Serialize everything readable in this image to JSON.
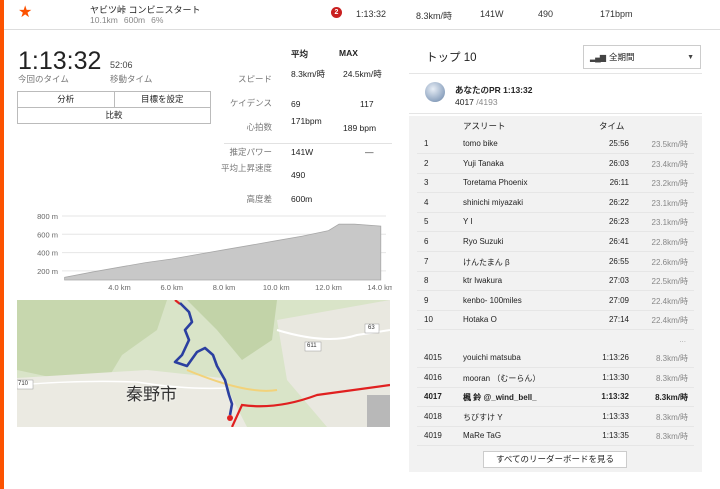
{
  "topbar": {
    "segment_name": "ヤビツ峠 コンビニスタート",
    "distance": "10.1km",
    "elev_gain": "600m",
    "grade": "6%",
    "badge": "2",
    "time": "1:13:32",
    "speed": "8.3km/時",
    "power": "141W",
    "vam": "490",
    "heartrate": "171bpm"
  },
  "effort": {
    "elapsed": "1:13:32",
    "elapsed_label": "今回のタイム",
    "moving": "52:06",
    "moving_label": "移動タイム",
    "buttons": {
      "analysis": "分析",
      "set_goal": "目標を設定",
      "compare": "比較"
    }
  },
  "stats": {
    "avg_header": "平均",
    "max_header": "MAX",
    "rows": [
      {
        "label": "スピード",
        "avg": "8.3km/時",
        "max": "24.5km/時"
      },
      {
        "label": "ケイデンス",
        "avg": "69",
        "max": "117"
      },
      {
        "label": "心拍数",
        "avg": "171bpm",
        "max": "189 bpm"
      },
      {
        "label": "推定パワー",
        "avg": "141W",
        "max": "—"
      },
      {
        "label": "平均上昇速度",
        "avg": "490",
        "max": ""
      },
      {
        "label": "高度差",
        "avg": "600m",
        "max": ""
      }
    ]
  },
  "chart_data": {
    "type": "area",
    "ylabel": "",
    "xlabel": "",
    "y_ticks": [
      "200 m",
      "400 m",
      "600 m",
      "800 m"
    ],
    "x_ticks": [
      "4.0 km",
      "6.0 km",
      "8.0 km",
      "10.0 km",
      "12.0 km",
      "14.0 km"
    ],
    "x_km": [
      1.9,
      3.0,
      4.0,
      5.0,
      6.0,
      7.0,
      8.0,
      9.0,
      10.0,
      11.0,
      12.0,
      12.4,
      13.0,
      14.0
    ],
    "elevation_m": [
      130,
      190,
      240,
      290,
      330,
      380,
      430,
      480,
      530,
      580,
      640,
      710,
      710,
      690
    ],
    "ylim": [
      100,
      800
    ],
    "xlim": [
      1.8,
      14.2
    ],
    "fill_color": "#c8c8c8"
  },
  "map": {
    "city_label": "秦野市",
    "route_labels": [
      "611",
      "63",
      "710"
    ],
    "route_color": "#2b3fa0",
    "road_color": "#e02020"
  },
  "leaderboard": {
    "title": "トップ 10",
    "filter": "全期間",
    "pr_line": "あなたのPR 1:13:32",
    "pr_rank": "4017",
    "pr_total": "/4193",
    "col_athlete": "アスリート",
    "col_time": "タイム",
    "top": [
      {
        "rank": "1",
        "name": "tomo bike",
        "time": "25:56",
        "speed": "23.5km/時"
      },
      {
        "rank": "2",
        "name": "Yuji Tanaka",
        "time": "26:03",
        "speed": "23.4km/時"
      },
      {
        "rank": "3",
        "name": "Toretama Phoenix",
        "time": "26:11",
        "speed": "23.2km/時"
      },
      {
        "rank": "4",
        "name": "shinichi miyazaki",
        "time": "26:22",
        "speed": "23.1km/時"
      },
      {
        "rank": "5",
        "name": "Y I",
        "time": "26:23",
        "speed": "23.1km/時"
      },
      {
        "rank": "6",
        "name": "Ryo Suzuki",
        "time": "26:41",
        "speed": "22.8km/時"
      },
      {
        "rank": "7",
        "name": "けんたまん β",
        "time": "26:55",
        "speed": "22.6km/時"
      },
      {
        "rank": "8",
        "name": "ktr Iwakura",
        "time": "27:03",
        "speed": "22.5km/時"
      },
      {
        "rank": "9",
        "name": "kenbo- 100miles",
        "time": "27:09",
        "speed": "22.4km/時"
      },
      {
        "rank": "10",
        "name": "Hotaka O",
        "time": "27:14",
        "speed": "22.4km/時"
      }
    ],
    "ellipsis": "...",
    "nearby": [
      {
        "rank": "4015",
        "name": "youichi matsuba",
        "time": "1:13:26",
        "speed": "8.3km/時"
      },
      {
        "rank": "4016",
        "name": "mooran （むーらん）",
        "time": "1:13:30",
        "speed": "8.3km/時"
      },
      {
        "rank": "4017",
        "name": "楓 鈴 @_wind_bell_",
        "time": "1:13:32",
        "speed": "8.3km/時"
      },
      {
        "rank": "4018",
        "name": "ちびすけ Y",
        "time": "1:13:33",
        "speed": "8.3km/時"
      },
      {
        "rank": "4019",
        "name": "MaRe TaG",
        "time": "1:13:35",
        "speed": "8.3km/時"
      }
    ],
    "view_all": "すべてのリーダーボードを見る"
  }
}
